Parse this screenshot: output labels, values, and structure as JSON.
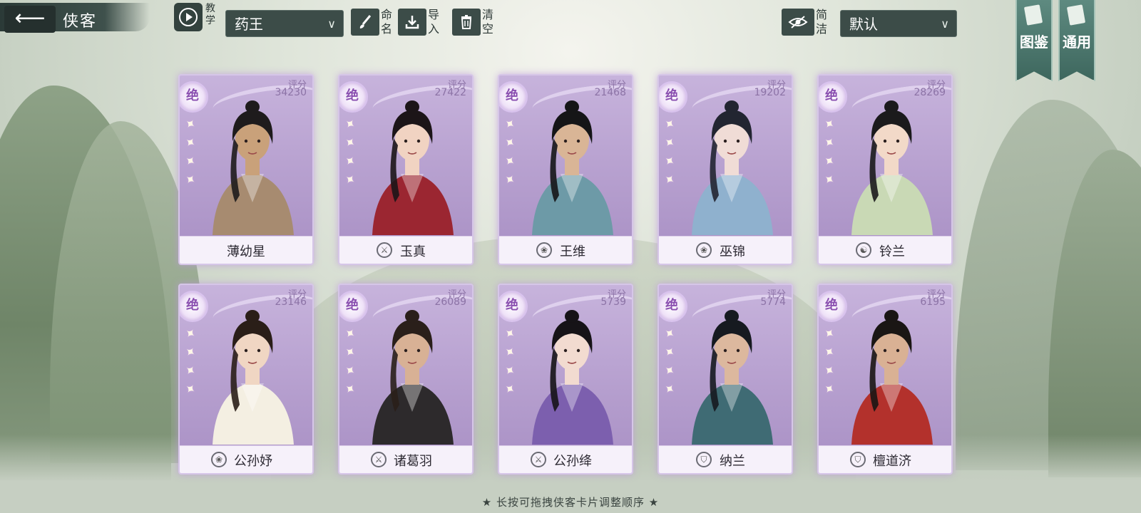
{
  "header": {
    "back_icon": "arrow-left-icon",
    "title": "侠客",
    "tutorial_label": "教学",
    "team_select_value": "药王",
    "rename_label": "命名",
    "import_label": "导入",
    "clear_label": "清空",
    "simple_label": "简洁",
    "sort_select_value": "默认",
    "codex_label": "图鉴",
    "general_label": "通用"
  },
  "cards": [
    {
      "name": "薄幼星",
      "score_label": "评分",
      "score": "34230",
      "rank": "绝",
      "sect_icon": "",
      "skin": "#c9a17a",
      "robe": "#a78b70",
      "hair": "#1e1b1c"
    },
    {
      "name": "玉真",
      "score_label": "评分",
      "score": "27422",
      "rank": "绝",
      "sect_icon": "sword-icon",
      "skin": "#f1d3c2",
      "robe": "#9b2631",
      "hair": "#1c1518"
    },
    {
      "name": "王维",
      "score_label": "评分",
      "score": "21468",
      "rank": "绝",
      "sect_icon": "lotus-icon",
      "skin": "#d9b596",
      "robe": "#6d9aa7",
      "hair": "#151517"
    },
    {
      "name": "巫锦",
      "score_label": "评分",
      "score": "19202",
      "rank": "绝",
      "sect_icon": "lotus-icon",
      "skin": "#f0dcd6",
      "robe": "#8fb1ce",
      "hair": "#222531"
    },
    {
      "name": "铃兰",
      "score_label": "评分",
      "score": "28269",
      "rank": "绝",
      "sect_icon": "taiji-icon",
      "skin": "#f2d9c8",
      "robe": "#c9d9b5",
      "hair": "#1b1a1c"
    },
    {
      "name": "公孙妤",
      "score_label": "评分",
      "score": "23146",
      "rank": "绝",
      "sect_icon": "lotus-icon",
      "skin": "#f0d6c3",
      "robe": "#f4efe2",
      "hair": "#2a1e18"
    },
    {
      "name": "诸葛羽",
      "score_label": "评分",
      "score": "26089",
      "rank": "绝",
      "sect_icon": "sword-icon",
      "skin": "#d8b195",
      "robe": "#2d2a2c",
      "hair": "#2a1f1a"
    },
    {
      "name": "公孙绛",
      "score_label": "评分",
      "score": "5739",
      "rank": "绝",
      "sect_icon": "sword-icon",
      "skin": "#f2dbd0",
      "robe": "#7c5fae",
      "hair": "#161317"
    },
    {
      "name": "纳兰",
      "score_label": "评分",
      "score": "5774",
      "rank": "绝",
      "sect_icon": "shield-icon",
      "skin": "#dcb89e",
      "robe": "#3f6b74",
      "hair": "#161a20"
    },
    {
      "name": "檀道济",
      "score_label": "评分",
      "score": "6195",
      "rank": "绝",
      "sect_icon": "shield-icon",
      "skin": "#d9b194",
      "robe": "#b3312c",
      "hair": "#1a1614"
    }
  ],
  "footer": {
    "hint": "★ 长按可拖拽侠客卡片调整顺序 ★"
  }
}
